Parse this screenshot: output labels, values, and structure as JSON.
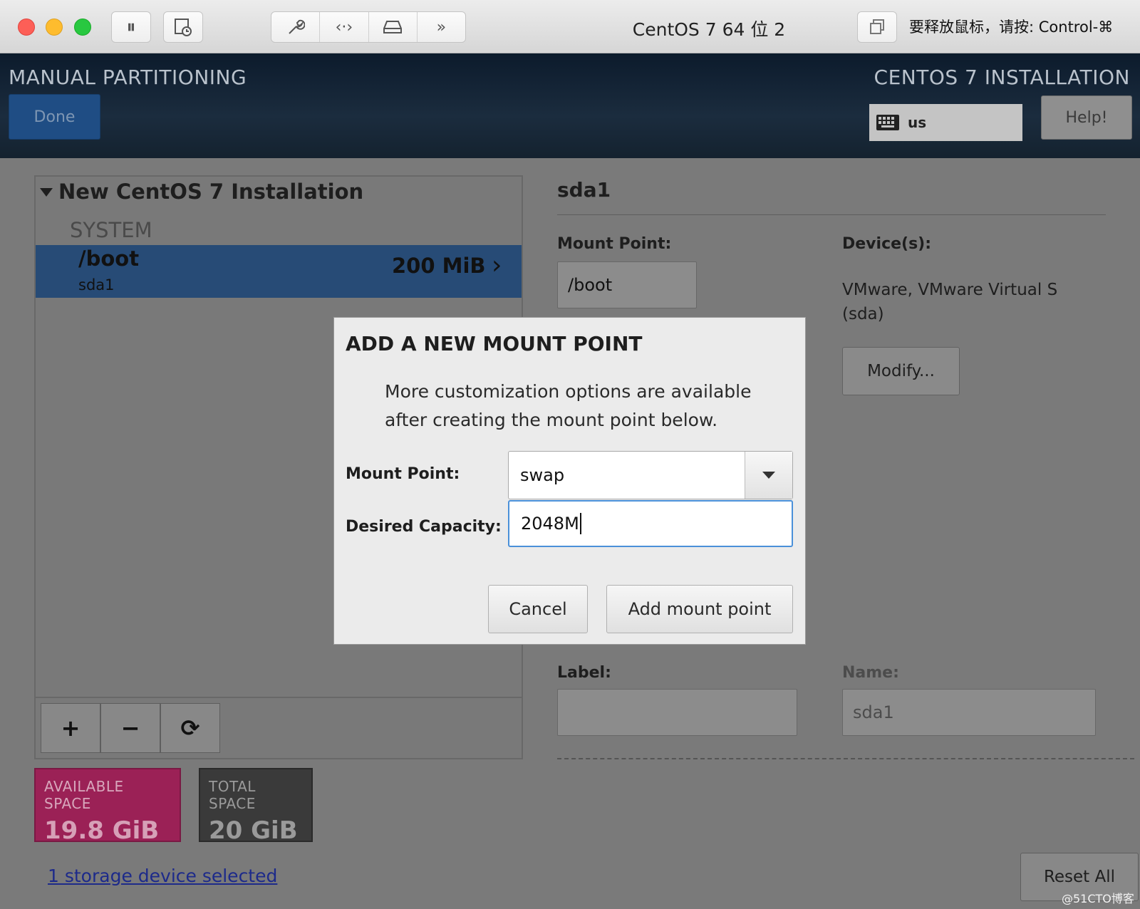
{
  "window": {
    "title": "CentOS 7 64 位 2",
    "release_hint": "要释放鼠标，请按: Control-⌘",
    "toolbar_icons": [
      "pause-icon",
      "snapshot-icon",
      "settings-wrench-icon",
      "code-arrows-icon",
      "disk-icon",
      "more-chevrons-icon",
      "window-copy-icon"
    ]
  },
  "header": {
    "title": "MANUAL PARTITIONING",
    "done_label": "Done",
    "installer_title": "CENTOS 7 INSTALLATION",
    "keyboard_layout": "us",
    "help_label": "Help!"
  },
  "partitions": {
    "group_title": "New CentOS 7 Installation",
    "section_label": "SYSTEM",
    "items": [
      {
        "mount": "/boot",
        "device": "sda1",
        "size": "200 MiB"
      }
    ],
    "tools": {
      "add": "+",
      "remove": "−",
      "refresh": "⟳"
    }
  },
  "space": {
    "available_label": "AVAILABLE SPACE",
    "available_value": "19.8 GiB",
    "total_label": "TOTAL SPACE",
    "total_value": "20 GiB",
    "available_color": "#9b2156",
    "total_color": "#3a3a3a"
  },
  "storage_link": "1 storage device selected",
  "details": {
    "title": "sda1",
    "mount_point_label": "Mount Point:",
    "mount_point_value": "/boot",
    "devices_label": "Device(s):",
    "devices_value_line1": "VMware, VMware Virtual S",
    "devices_value_line2": "(sda)",
    "modify_label": "Modify...",
    "label_label": "Label:",
    "label_value": "",
    "name_label": "Name:",
    "name_value": "sda1",
    "reset_label": "Reset All"
  },
  "dialog": {
    "title": "ADD A NEW MOUNT POINT",
    "desc_line1": "More customization options are available",
    "desc_line2": "after creating the mount point below.",
    "mount_point_label": "Mount Point:",
    "mount_point_value": "swap",
    "capacity_label": "Desired Capacity:",
    "capacity_value": "2048M",
    "cancel_label": "Cancel",
    "add_label": "Add mount point"
  },
  "watermark": "@51CTO博客"
}
